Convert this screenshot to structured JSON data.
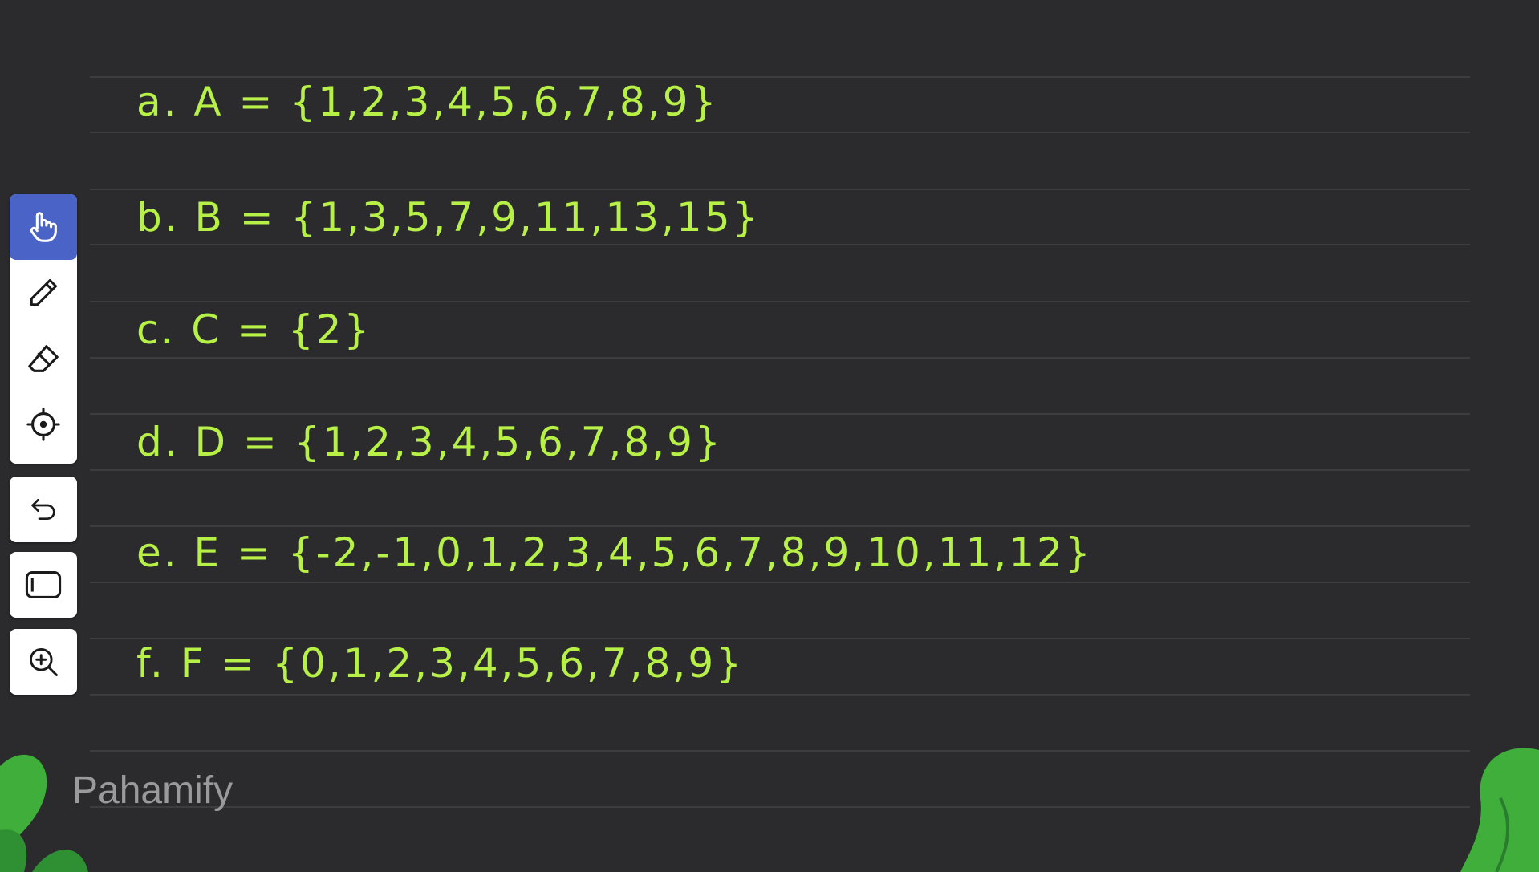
{
  "board": {
    "lines": [
      "a. A = {1,2,3,4,5,6,7,8,9}",
      "b. B = {1,3,5,7,9,11,13,15}",
      "c. C = {2}",
      "d. D = {1,2,3,4,5,6,7,8,9}",
      "e. E = {-2,-1,0,1,2,3,4,5,6,7,8,9,10,11,12}",
      "f. F = {0,1,2,3,4,5,6,7,8,9}"
    ]
  },
  "toolbar": {
    "tools": [
      "hand-icon",
      "pen-icon",
      "eraser-icon",
      "laser-pointer-icon",
      "undo-icon",
      "rectangle-icon",
      "zoom-in-icon"
    ],
    "active": "hand-icon",
    "accent": "#4a63c7"
  },
  "brand": {
    "logo_text": "Pahamify"
  },
  "colors": {
    "background": "#2b2b2d",
    "ink": "#b7f046",
    "leaf": "#3fae3a"
  }
}
